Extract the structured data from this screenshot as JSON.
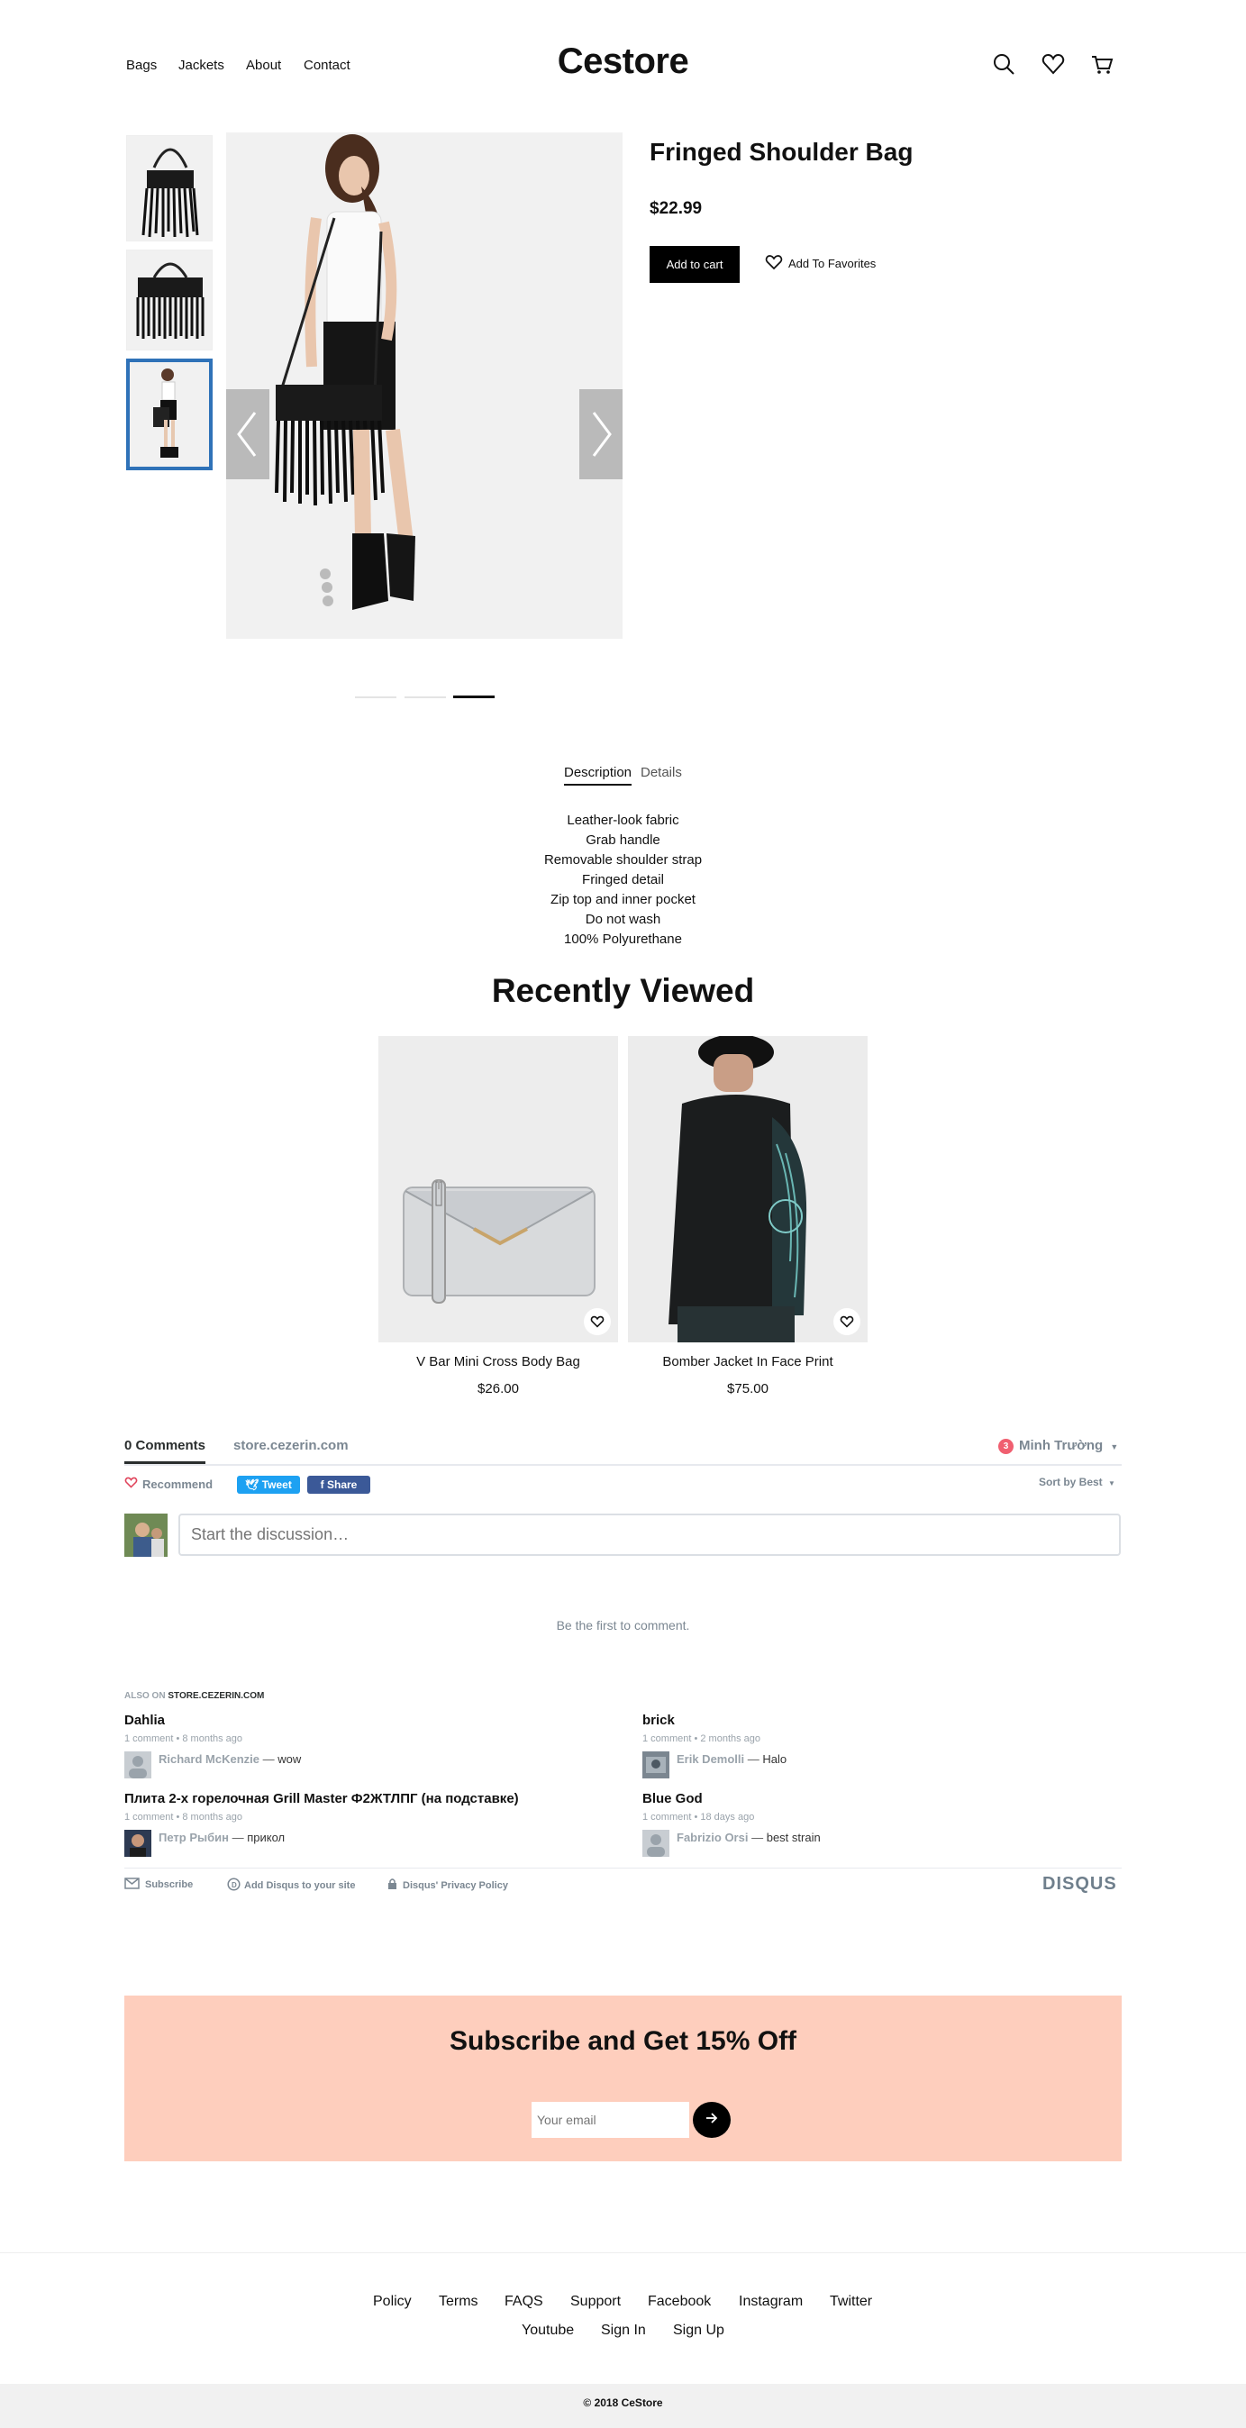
{
  "header": {
    "nav": [
      "Bags",
      "Jackets",
      "About",
      "Contact"
    ],
    "logo": "Cestore"
  },
  "product": {
    "title": "Fringed Shoulder Bag",
    "price": "$22.99",
    "add_to_cart": "Add to cart",
    "add_to_favorites": "Add To Favorites",
    "active_image_index": 3,
    "image_count": 3
  },
  "tabs": {
    "description": "Description",
    "details": "Details",
    "active": "Description"
  },
  "description_lines": [
    "Leather-look fabric",
    "Grab handle",
    "Removable shoulder strap",
    "Fringed detail",
    "Zip top and inner pocket",
    "Do not wash",
    "100% Polyurethane"
  ],
  "recently_viewed": {
    "title": "Recently Viewed",
    "items": [
      {
        "name": "V Bar Mini Cross Body Bag",
        "price": "$26.00"
      },
      {
        "name": "Bomber Jacket In Face Print",
        "price": "$75.00"
      }
    ]
  },
  "comments": {
    "count_label": "0 Comments",
    "site": "store.cezerin.com",
    "user": "Minh Trường",
    "notification_count": "3",
    "recommend": "Recommend",
    "tweet": "Tweet",
    "share": "Share",
    "sort": "Sort by Best",
    "placeholder": "Start the discussion…",
    "empty": "Be the first to comment.",
    "also_on_prefix": "ALSO ON",
    "also_on_site": "STORE.CEZERIN.COM",
    "threads": [
      {
        "title": "Dahlia",
        "meta": "1 comment • 8 months ago",
        "author": "Richard McKenzie",
        "text": "wow"
      },
      {
        "title": "brick",
        "meta": "1 comment • 2 months ago",
        "author": "Erik Demolli",
        "text": "Halo"
      },
      {
        "title": "Плита 2-х горелочная Grill Master Ф2ЖТЛПГ (на подставке)",
        "meta": "1 comment • 8 months ago",
        "author": "Петр Рыбин",
        "text": "прикол"
      },
      {
        "title": "Blue God",
        "meta": "1 comment • 18 days ago",
        "author": "Fabrizio Orsi",
        "text": "best strain"
      }
    ],
    "footer": {
      "subscribe": "Subscribe",
      "add_disqus": "Add Disqus to your site",
      "privacy": "Disqus' Privacy Policy",
      "brand": "DISQUS"
    }
  },
  "subscribe": {
    "title": "Subscribe and Get 15% Off",
    "placeholder": "Your email"
  },
  "footer": {
    "links_row1": [
      "Policy",
      "Terms",
      "FAQS",
      "Support",
      "Facebook",
      "Instagram",
      "Twitter"
    ],
    "links_row2": [
      "Youtube",
      "Sign In",
      "Sign Up"
    ],
    "copyright": "© 2018 CeStore"
  },
  "colors": {
    "accent_blue": "#2f72b8",
    "subscribe_bg": "#fecebd",
    "tweet_blue": "#1da1f2",
    "facebook_blue": "#3b5998",
    "badge_red": "#f05f70"
  }
}
